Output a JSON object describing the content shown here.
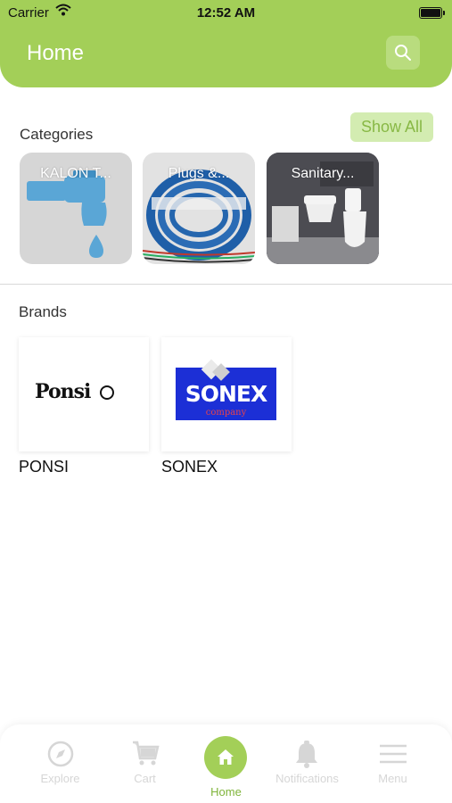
{
  "status_bar": {
    "carrier": "Carrier",
    "time": "12:52 AM"
  },
  "header": {
    "title": "Home",
    "search_icon": "search-icon"
  },
  "categories": {
    "title": "Categories",
    "show_all_label": "Show All",
    "items": [
      {
        "label": "KALON T...",
        "image": "water-tap"
      },
      {
        "label": "Plugs &...",
        "image": "cable-coil"
      },
      {
        "label": "Sanitary...",
        "image": "bathroom"
      }
    ]
  },
  "brands": {
    "title": "Brands",
    "items": [
      {
        "name": "PONSI",
        "logo_text": "Ponsi"
      },
      {
        "name": "SONEX",
        "logo_text": "SONEX",
        "logo_subtext": "company"
      }
    ]
  },
  "tabbar": {
    "items": [
      {
        "label": "Explore",
        "icon": "compass-icon"
      },
      {
        "label": "Cart",
        "icon": "cart-icon"
      },
      {
        "label": "Home",
        "icon": "home-icon",
        "active": true
      },
      {
        "label": "Notifications",
        "icon": "bell-icon"
      },
      {
        "label": "Menu",
        "icon": "menu-icon"
      }
    ]
  },
  "colors": {
    "accent": "#a3cf58",
    "show_all_bg": "#d3ecb1",
    "show_all_text": "#88b845",
    "inactive_tab": "#d6d6d6"
  }
}
